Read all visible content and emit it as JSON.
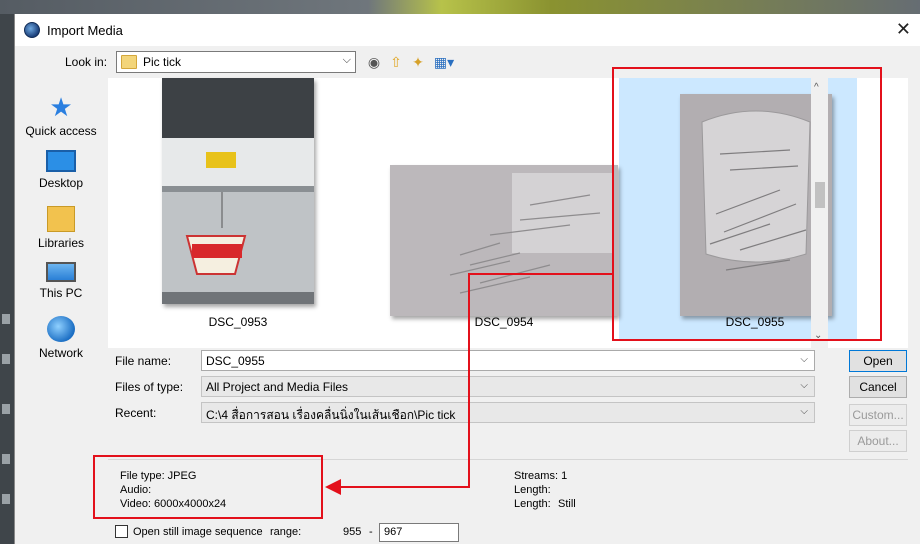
{
  "dialog": {
    "title": "Import Media"
  },
  "lookin": {
    "label": "Look in:",
    "folder": "Pic tick"
  },
  "places": [
    {
      "label": "Quick access",
      "icon": "quick-access-icon"
    },
    {
      "label": "Desktop",
      "icon": "desktop-icon"
    },
    {
      "label": "Libraries",
      "icon": "libraries-icon"
    },
    {
      "label": "This PC",
      "icon": "this-pc-icon"
    },
    {
      "label": "Network",
      "icon": "network-icon"
    }
  ],
  "files": [
    {
      "name": "DSC_0953",
      "selected": false
    },
    {
      "name": "DSC_0954",
      "selected": false
    },
    {
      "name": "DSC_0955",
      "selected": true
    }
  ],
  "form": {
    "filename_label": "File name:",
    "filename_value": "DSC_0955",
    "filetype_label": "Files of type:",
    "filetype_value": "All Project and Media Files",
    "recent_label": "Recent:",
    "recent_value": "C:\\4 สื่อการสอน เรื่องคลื่นนิ่งในเส้นเชือก\\Pic tick"
  },
  "buttons": {
    "open": "Open",
    "cancel": "Cancel",
    "custom": "Custom...",
    "about": "About..."
  },
  "info": {
    "filetype": "File type: JPEG",
    "audio": "Audio:",
    "video_label": "Video:",
    "video_value": "6000x4000x24",
    "streams": "Streams: 1",
    "length1": "Length:",
    "length2_label": "Length:",
    "length2_value": "Still"
  },
  "bottom": {
    "sequence_label": "Open still image sequence",
    "range_label": "range:",
    "range_start": "955",
    "range_sep": "-",
    "range_end": "967"
  },
  "colors": {
    "annotation": "#e3101b",
    "selection": "#cce8ff"
  }
}
